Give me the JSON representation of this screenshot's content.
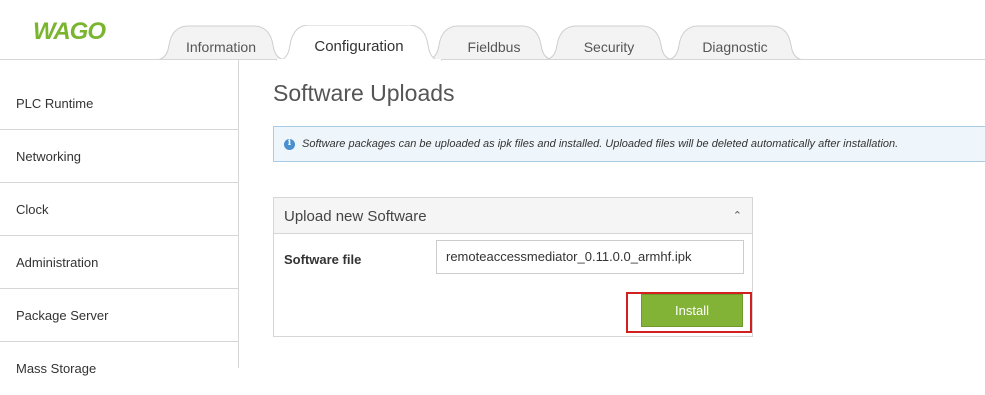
{
  "brand": {
    "logo_text": "WAGO",
    "logo_color": "#7bb530"
  },
  "tabs": [
    {
      "label": "Information",
      "active": false
    },
    {
      "label": "Configuration",
      "active": true
    },
    {
      "label": "Fieldbus",
      "active": false
    },
    {
      "label": "Security",
      "active": false
    },
    {
      "label": "Diagnostic",
      "active": false
    }
  ],
  "sidebar": {
    "items": [
      {
        "label": "PLC Runtime"
      },
      {
        "label": "Networking"
      },
      {
        "label": "Clock"
      },
      {
        "label": "Administration"
      },
      {
        "label": "Package Server"
      },
      {
        "label": "Mass Storage"
      }
    ]
  },
  "main": {
    "title": "Software Uploads",
    "info": {
      "icon": "info-icon",
      "text": "Software packages can be uploaded as ipk files and installed. Uploaded files will be deleted automatically after installation."
    },
    "panel": {
      "title": "Upload new Software",
      "collapse_icon": "chevron-up-icon",
      "field_label": "Software file",
      "file_value": "remoteaccessmediator_0.11.0.0_armhf.ipk",
      "install_label": "Install"
    }
  },
  "colors": {
    "accent": "#82b336",
    "highlight": "#d21f1f",
    "info_border": "#a9cbe3"
  }
}
